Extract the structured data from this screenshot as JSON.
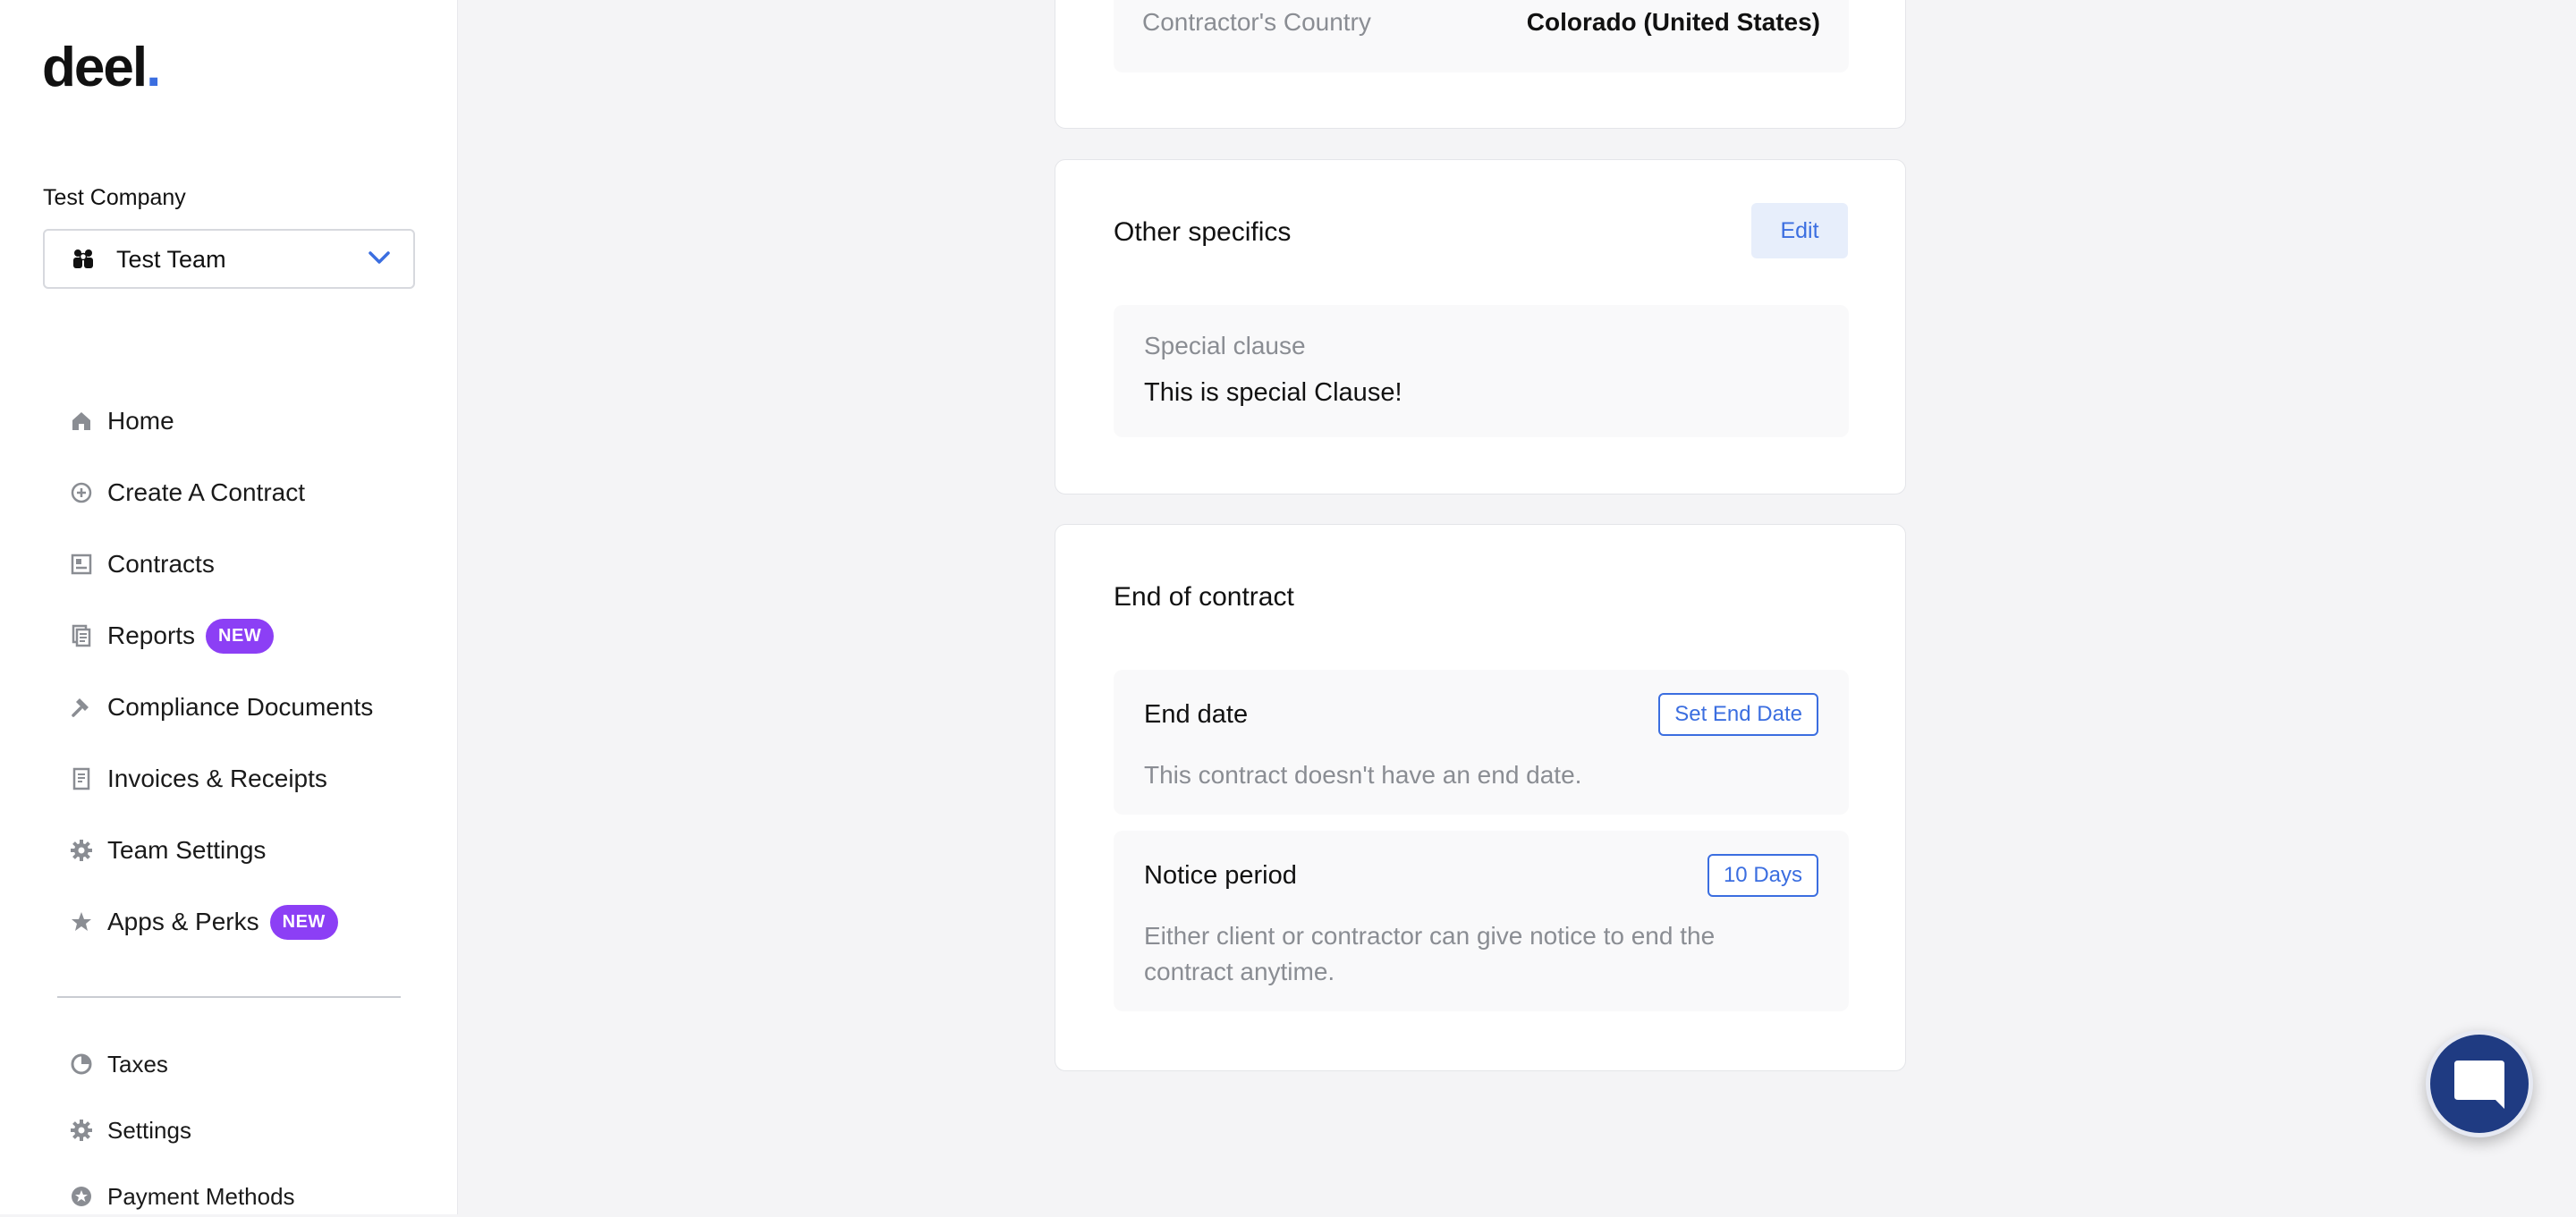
{
  "brand": {
    "logo_text": "deel",
    "logo_dot": ".",
    "accent": "#3b6ee0"
  },
  "sidebar": {
    "company_label": "Test Company",
    "team_select": {
      "value": "Test Team"
    },
    "items": [
      {
        "label": "Home",
        "icon": "home-icon"
      },
      {
        "label": "Create A Contract",
        "icon": "plus-circle-icon"
      },
      {
        "label": "Contracts",
        "icon": "contracts-icon"
      },
      {
        "label": "Reports",
        "icon": "reports-icon",
        "badge": "NEW"
      },
      {
        "label": "Compliance Documents",
        "icon": "hammer-icon"
      },
      {
        "label": "Invoices & Receipts",
        "icon": "receipt-icon"
      },
      {
        "label": "Team Settings",
        "icon": "gear-icon"
      },
      {
        "label": "Apps & Perks",
        "icon": "star-icon",
        "badge": "NEW"
      }
    ],
    "secondary_items": [
      {
        "label": "Taxes",
        "icon": "pie-chart-icon"
      },
      {
        "label": "Settings",
        "icon": "gear-icon"
      },
      {
        "label": "Payment Methods",
        "icon": "payment-icon"
      }
    ],
    "badge_color": "#8c3ff5"
  },
  "main": {
    "country_row": {
      "label": "Contractor's Country",
      "value": "Colorado (United States)"
    },
    "other_specifics": {
      "title": "Other specifics",
      "edit_label": "Edit",
      "special_clause_label": "Special clause",
      "special_clause_value": "This is special Clause!"
    },
    "end_of_contract": {
      "title": "End of contract",
      "end_date": {
        "label": "End date",
        "button": "Set End Date",
        "description": "This contract doesn't have an end date."
      },
      "notice_period": {
        "label": "Notice period",
        "button": "10 Days",
        "description_line1": "Either client or contractor can give notice to end the",
        "description_line2": "contract anytime."
      }
    }
  }
}
